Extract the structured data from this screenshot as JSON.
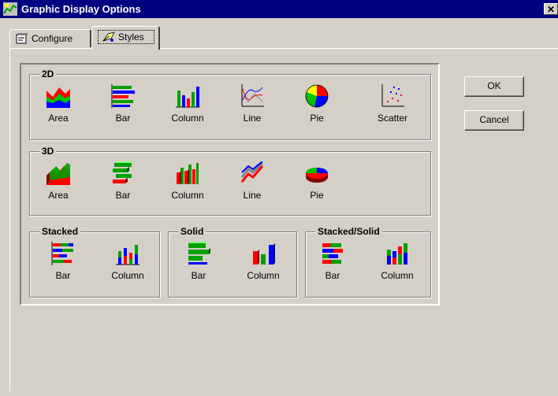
{
  "window": {
    "title": "Graphic Display Options",
    "close_label": "✕"
  },
  "tabs": [
    {
      "label": "Configure",
      "icon": "configure-icon",
      "selected": false
    },
    {
      "label": "Styles",
      "icon": "styles-icon",
      "selected": true
    }
  ],
  "groups": {
    "g2d": {
      "label": "2D",
      "items": [
        "Area",
        "Bar",
        "Column",
        "Line",
        "Pie",
        "Scatter"
      ]
    },
    "g3d": {
      "label": "3D",
      "items": [
        "Area",
        "Bar",
        "Column",
        "Line",
        "Pie"
      ]
    },
    "stacked": {
      "label": "Stacked",
      "items": [
        "Bar",
        "Column"
      ]
    },
    "solid": {
      "label": "Solid",
      "items": [
        "Bar",
        "Column"
      ]
    },
    "stacked_solid": {
      "label": "Stacked/Solid",
      "items": [
        "Bar",
        "Column"
      ]
    }
  },
  "buttons": {
    "ok": "OK",
    "cancel": "Cancel"
  },
  "colors": {
    "title_bar": "#000080",
    "face": "#d4d0c8",
    "chart_red": "#ff0000",
    "chart_green": "#00c000",
    "chart_blue": "#0000ff",
    "chart_yellow": "#ffff00"
  }
}
